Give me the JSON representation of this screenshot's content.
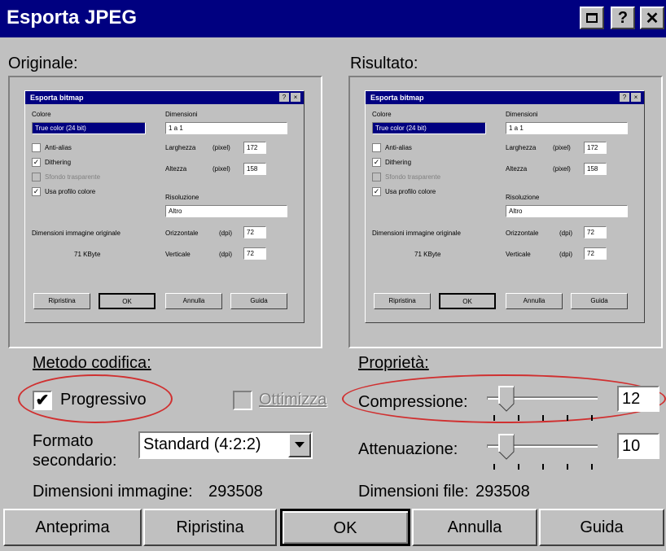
{
  "window": {
    "title": "Esporta JPEG",
    "buttons": [
      "restore-icon",
      "?",
      "✕"
    ]
  },
  "preview": {
    "left_label": "Originale:",
    "right_label": "Risultato:",
    "mini_dialog": {
      "title": "Esporta bitmap",
      "labels": {
        "colors": "Colore",
        "dimensions": "Dimensioni",
        "color_value": "True color (24 bit)",
        "dim_value": "1 a 1",
        "antialias": "Anti-alias",
        "dithering": "Dithering",
        "transparent": "Sfondo trasparente",
        "profile": "Usa profilo colore",
        "width": "Larghezza",
        "height": "Altezza",
        "unit_px": "(pixel)",
        "w_val": "172",
        "h_val": "158",
        "resolution": "Risoluzione",
        "res_value": "Altro",
        "orig_size": "Dimensioni immagine originale",
        "horizontal": "Orizzontale",
        "vertical": "Verticale",
        "dpi": "(dpi)",
        "hr_val": "72",
        "vr_val": "72",
        "size_val": "71 KByte",
        "reset": "Ripristina",
        "ok": "OK",
        "cancel": "Annulla",
        "help": "Guida"
      }
    }
  },
  "encoding": {
    "label": "Metodo codifica:",
    "progressive_label": "Progressivo",
    "progressive_checked": true,
    "optimize_label": "Ottimizza",
    "optimize_enabled": false
  },
  "subformat": {
    "label": "Formato secondario:",
    "value": "Standard (4:2:2)"
  },
  "image_size": {
    "label": "Dimensioni immagine:",
    "value": "293508"
  },
  "properties": {
    "label": "Proprietà:",
    "compression_label": "Compressione:",
    "compression_value": "12",
    "smoothing_label": "Attenuazione:",
    "smoothing_value": "10"
  },
  "file_size": {
    "label": "Dimensioni file:",
    "value": "293508"
  },
  "buttons": {
    "preview": "Anteprima",
    "reset": "Ripristina",
    "ok": "OK",
    "cancel": "Annulla",
    "help": "Guida"
  },
  "colors": {
    "titlebar": "#000080",
    "face": "#c0c0c0",
    "highlight_ellipse": "#d03030"
  }
}
